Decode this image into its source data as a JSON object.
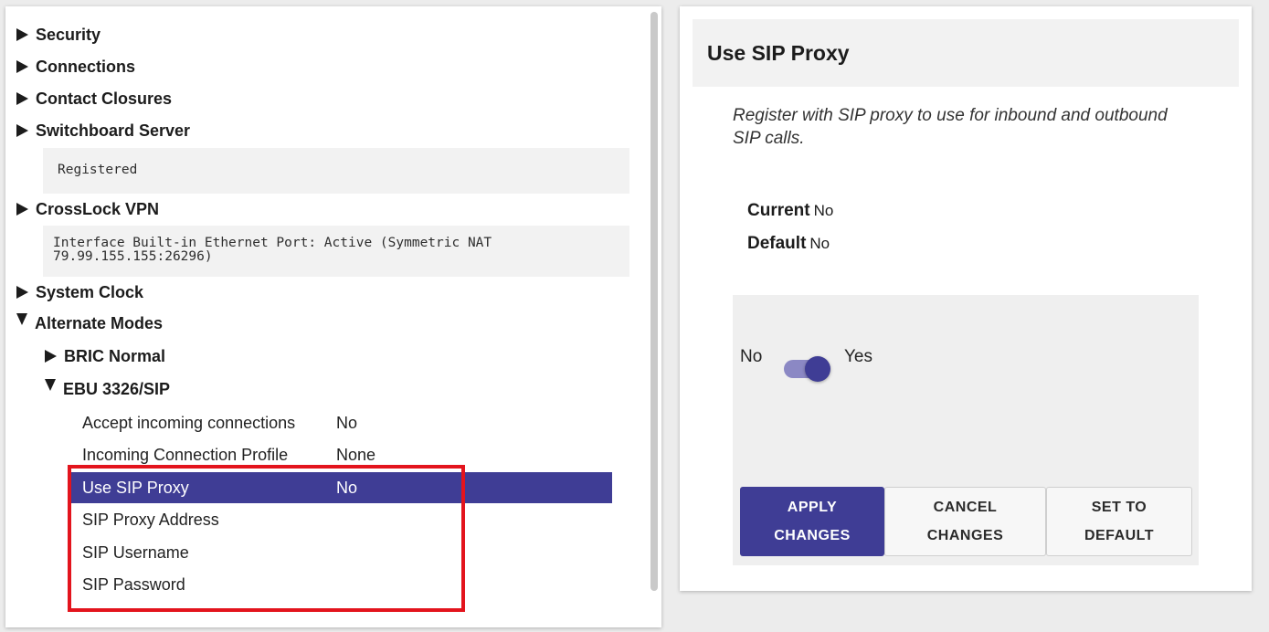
{
  "tree": {
    "items": [
      {
        "label": "Security",
        "state": "collapsed"
      },
      {
        "label": "Connections",
        "state": "collapsed"
      },
      {
        "label": "Contact Closures",
        "state": "collapsed"
      },
      {
        "label": "Switchboard Server",
        "state": "collapsed",
        "status": "Registered"
      },
      {
        "label": "CrossLock VPN",
        "state": "collapsed",
        "status": "Interface Built-in Ethernet Port: Active (Symmetric NAT\n79.99.155.155:26296)"
      },
      {
        "label": "System Clock",
        "state": "collapsed"
      },
      {
        "label": "Alternate Modes",
        "state": "expanded"
      }
    ],
    "alternate_modes": [
      {
        "label": "BRIC Normal",
        "state": "collapsed"
      },
      {
        "label": "EBU 3326/SIP",
        "state": "expanded"
      }
    ],
    "properties": [
      {
        "name": "Accept incoming connections",
        "value": "No"
      },
      {
        "name": "Incoming Connection Profile",
        "value": "None"
      },
      {
        "name": "Use SIP Proxy",
        "value": "No",
        "selected": true
      },
      {
        "name": "SIP Proxy Address",
        "value": ""
      },
      {
        "name": "SIP Username",
        "value": ""
      },
      {
        "name": "SIP Password",
        "value": ""
      }
    ]
  },
  "detail": {
    "title": "Use SIP Proxy",
    "description": "Register with SIP proxy to use for inbound and outbound SIP calls.",
    "current_label": "Current",
    "current_value": "No",
    "default_label": "Default",
    "default_value": "No",
    "toggle": {
      "off_label": "No",
      "on_label": "Yes",
      "value": true
    },
    "buttons": {
      "apply": "APPLY\nCHANGES",
      "cancel": "CANCEL\nCHANGES",
      "default": "SET TO\nDEFAULT"
    }
  },
  "colors": {
    "accent": "#3f3d95",
    "highlight_frame": "#e3141d",
    "toggle_track": "#8b88c4"
  },
  "icons": {
    "collapsed": "triangle-right-icon",
    "expanded": "triangle-down-icon"
  }
}
